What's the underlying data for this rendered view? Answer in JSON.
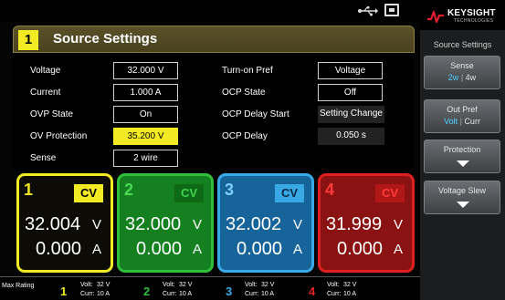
{
  "brand": {
    "name": "KEYSIGHT",
    "sub": "TECHNOLOGIES"
  },
  "panel": {
    "number": "1",
    "title": "Source Settings",
    "left_rows": [
      {
        "label": "Voltage",
        "value": "32.000  V"
      },
      {
        "label": "Current",
        "value": "1.000  A"
      },
      {
        "label": "OVP State",
        "value": "On"
      },
      {
        "label": "OV Protection",
        "value": "35.200  V"
      },
      {
        "label": "Sense",
        "value": "2 wire"
      }
    ],
    "right_rows": [
      {
        "label": "Turn-on Pref",
        "value": "Voltage"
      },
      {
        "label": "OCP State",
        "value": "Off"
      },
      {
        "label": "OCP Delay Start",
        "value": "Setting Change"
      },
      {
        "label": "OCP Delay",
        "value": "0.050  s"
      }
    ]
  },
  "channels": [
    {
      "num": "1",
      "mode": "CV",
      "volt": "32.004",
      "amp": "0.000",
      "vunit": "V",
      "aunit": "A"
    },
    {
      "num": "2",
      "mode": "CV",
      "volt": "32.000",
      "amp": "0.000",
      "vunit": "V",
      "aunit": "A"
    },
    {
      "num": "3",
      "mode": "CV",
      "volt": "32.002",
      "amp": "0.000",
      "vunit": "V",
      "aunit": "A"
    },
    {
      "num": "4",
      "mode": "CV",
      "volt": "31.999",
      "amp": "0.000",
      "vunit": "V",
      "aunit": "A"
    }
  ],
  "colors": {
    "ch1": "#f2ea22",
    "ch2": "#2fbf3a",
    "ch3": "#39a9e6",
    "ch4": "#e02020",
    "accent": "#4fd2ff"
  },
  "max_rating": {
    "label": "Max Rating",
    "volt_label": "Volt:",
    "curr_label": "Curr:",
    "entries": [
      {
        "num": "1",
        "volt": "32  V",
        "curr": "10  A"
      },
      {
        "num": "2",
        "volt": "32  V",
        "curr": "10  A"
      },
      {
        "num": "3",
        "volt": "32  V",
        "curr": "10  A"
      },
      {
        "num": "4",
        "volt": "32  V",
        "curr": "10  A"
      }
    ]
  },
  "sidebar": {
    "menu_title": "Source Settings",
    "softkeys": [
      {
        "label": "Sense",
        "opt_on": "2w",
        "opt_off": "4w"
      },
      {
        "label": "Out Pref",
        "opt_on": "Volt",
        "opt_off": "Curr"
      },
      {
        "label": "Protection"
      },
      {
        "label": "Voltage Slew"
      }
    ]
  }
}
